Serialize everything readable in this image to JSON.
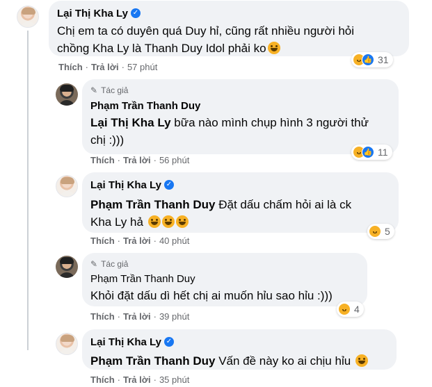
{
  "comments": [
    {
      "author": "Lại Thị Kha Ly",
      "verified": true,
      "lines": [
        "Chị em ta có duyên quá Duy hỉ, cũng rất nhiều người hỏi",
        "chồng Kha Ly là Thanh Duy Idol phải ko"
      ],
      "emoji_after": 1,
      "actions": {
        "like": "Thích",
        "reply": "Trả lời",
        "time": "57 phút"
      },
      "reaction_count": "31",
      "reaction_types": [
        "haha",
        "like"
      ]
    },
    {
      "author": "Phạm Trần Thanh Duy",
      "role": "Tác giả",
      "tag": "Lại Thị Kha Ly",
      "lines": [
        " bữa nào mình chụp hình 3 người thử",
        "chị :)))"
      ],
      "actions": {
        "like": "Thích",
        "reply": "Trả lời",
        "time": "56 phút"
      },
      "reaction_count": "11",
      "reaction_types": [
        "haha",
        "like"
      ]
    },
    {
      "author": "Lại Thị Kha Ly",
      "verified": true,
      "tag": "Phạm Trần Thanh Duy",
      "lines": [
        " Đặt dấu chấm hỏi ai là ck",
        "Kha Ly hả "
      ],
      "emoji_after": 3,
      "actions": {
        "like": "Thích",
        "reply": "Trả lời",
        "time": "40 phút"
      },
      "reaction_count": "5",
      "reaction_types": [
        "haha"
      ]
    },
    {
      "author": "Phạm Trần Thanh Duy",
      "role": "Tác giả",
      "lines": [
        "Khỏi đặt dấu dì hết chị ai muốn hỉu sao hỉu :)))"
      ],
      "actions": {
        "like": "Thích",
        "reply": "Trả lời",
        "time": "39 phút"
      },
      "reaction_count": "4",
      "reaction_types": [
        "haha"
      ]
    },
    {
      "author": "Lại Thị Kha Ly",
      "verified": true,
      "tag": "Phạm Trần Thanh Duy",
      "lines": [
        " Vấn đề này ko ai chịu hỉu "
      ],
      "emoji_after": 1,
      "actions": {
        "like": "Thích",
        "reply": "Trả lời",
        "time": "35 phút"
      }
    }
  ],
  "icons": {
    "verified": "verified-badge-icon",
    "author_role": "pen-icon",
    "reaction_haha": "haha-reaction-icon",
    "reaction_like": "like-reaction-icon",
    "inline_emoji": "rofl-emoji-icon"
  },
  "colors": {
    "bubble_bg": "#f0f2f5",
    "meta_text": "#65676b",
    "verified_blue": "#1877f2",
    "haha_yellow": "#f7b125"
  },
  "glyphs": {
    "dot": "·",
    "check": "✓",
    "pen": "✎",
    "thumb": "👍"
  }
}
